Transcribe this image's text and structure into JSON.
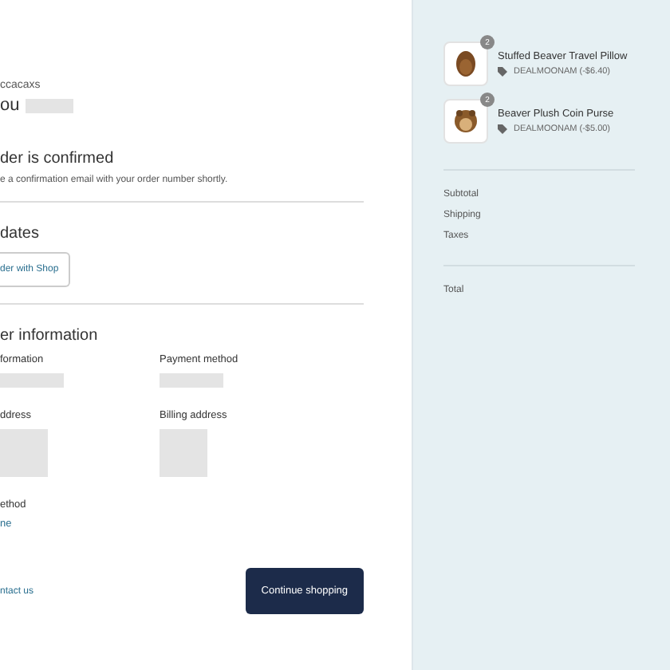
{
  "header": {
    "caption": "ccacaxs",
    "greeting": "ou"
  },
  "confirmed": {
    "title": "der is confirmed",
    "message": "e a confirmation email with your order number shortly."
  },
  "updates": {
    "title": "dates",
    "button": "der with Shop"
  },
  "info": {
    "title": "er information",
    "fields": [
      {
        "label": "formation",
        "blurred": true
      },
      {
        "label": "Payment method",
        "blurred": true
      },
      {
        "label": "ddress",
        "blurred": true
      },
      {
        "label": "Billing address",
        "blurred": true
      }
    ],
    "shipping_label": "ethod",
    "shipping_value": "ne"
  },
  "footer": {
    "help": "ntact us",
    "button": "Continue shopping"
  },
  "items": [
    {
      "name": "Stuffed Beaver Travel Pillow",
      "discount": "DEALMOONAM (-$6.40)",
      "quantity": "2",
      "kind": "pillow"
    },
    {
      "name": "Beaver Plush Coin Purse",
      "discount": "DEALMOONAM (-$5.00)",
      "quantity": "2",
      "kind": "purse"
    }
  ],
  "summary": [
    "Subtotal",
    "Shipping",
    "Taxes"
  ],
  "total": "Total"
}
